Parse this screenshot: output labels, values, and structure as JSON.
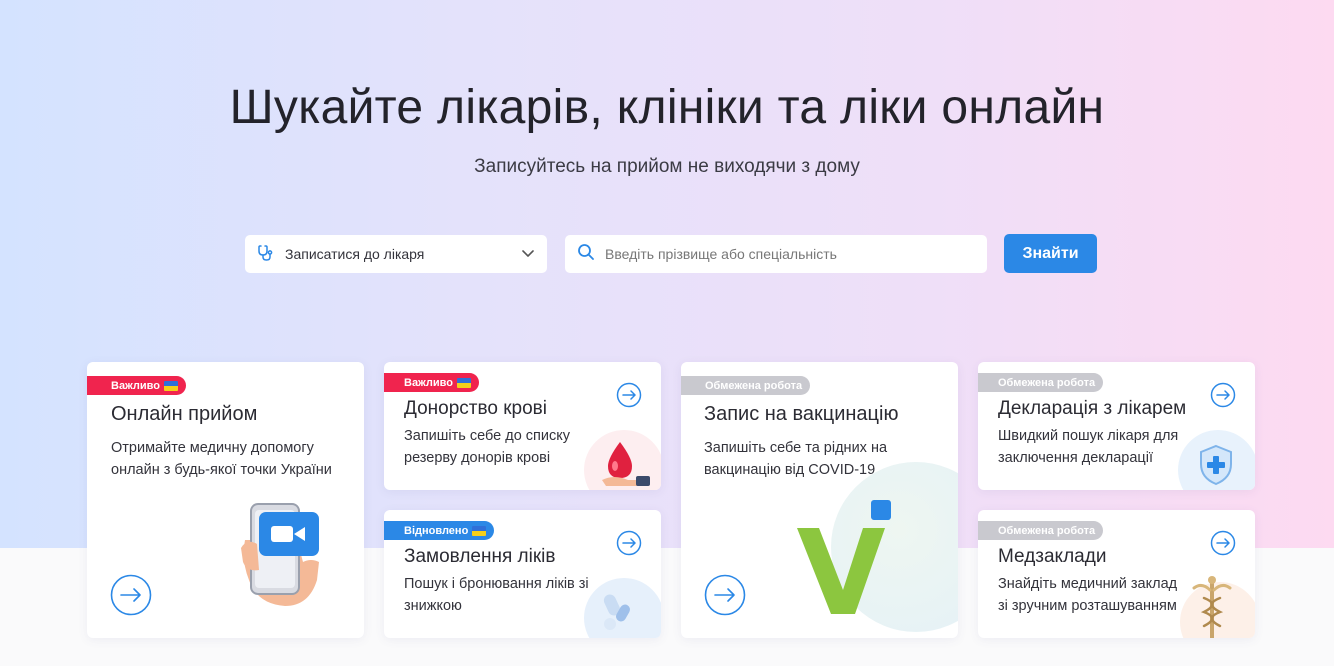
{
  "hero": {
    "title": "Шукайте лікарів, клініки та ліки онлайн",
    "subtitle": "Записуйтесь на прийом не виходячи з дому"
  },
  "search": {
    "select_value": "Записатися до лікаря",
    "select_icon": "stethoscope-icon",
    "input_placeholder": "Введіть прізвище або спеціальність",
    "input_value": "",
    "button_label": "Знайти"
  },
  "cards": [
    {
      "badge": "Важливо",
      "title": "Онлайн прийом",
      "desc_lines": [
        "Отримайте медичну допомогу",
        "онлайн з будь-якої точки України"
      ]
    },
    {
      "badge": "Важливо",
      "title": "Донорство крові",
      "desc_lines": [
        "Запишіть себе до списку",
        "резерву донорів крові"
      ]
    },
    {
      "badge": "Відновлено",
      "title": "Замовлення ліків",
      "desc_lines": [
        "Пошук і бронювання ліків зі",
        "знижкою"
      ]
    },
    {
      "badge": "Обмежена робота",
      "title": "Запис на вакцинацію",
      "desc_lines": [
        "Запишіть себе та рідних на",
        "вакцинацію від COVID-19"
      ]
    },
    {
      "badge": "Обмежена робота",
      "title": "Декларація з лікарем",
      "desc_lines": [
        "Швидкий пошук лікаря для",
        "заключення декларації"
      ]
    },
    {
      "badge": "Обмежена робота",
      "title": "Медзаклади",
      "desc_lines": [
        "Знайдіть медичний заклад",
        "зі зручним розташуванням"
      ]
    }
  ],
  "colors": {
    "accent": "#2b88e6",
    "badge_important": "#f0244e",
    "badge_restored": "#2b88e6",
    "badge_limited": "#c9c9cf"
  }
}
